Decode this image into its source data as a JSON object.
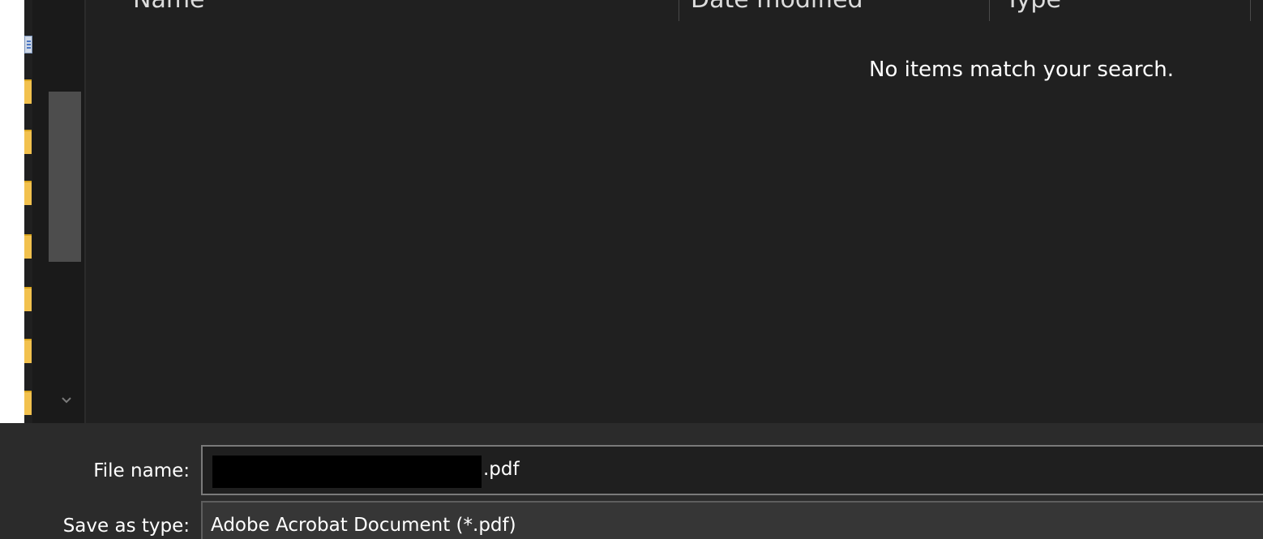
{
  "file_list": {
    "columns": [
      "Name",
      "Date modified",
      "Type"
    ],
    "empty_message": "No items match your search."
  },
  "save_form": {
    "file_name_label": "File name:",
    "file_name_value": ".pdf",
    "save_as_type_label": "Save as type:",
    "save_as_type_value": "Adobe Acrobat Document (*.pdf)"
  },
  "icons": {
    "folder": "folder-icon",
    "document": "document-icon",
    "scroll_down": "chevron-down-icon"
  },
  "colors": {
    "background": "#202020",
    "bottom_panel": "#2b2b2b",
    "folder": "#f2c14e"
  }
}
